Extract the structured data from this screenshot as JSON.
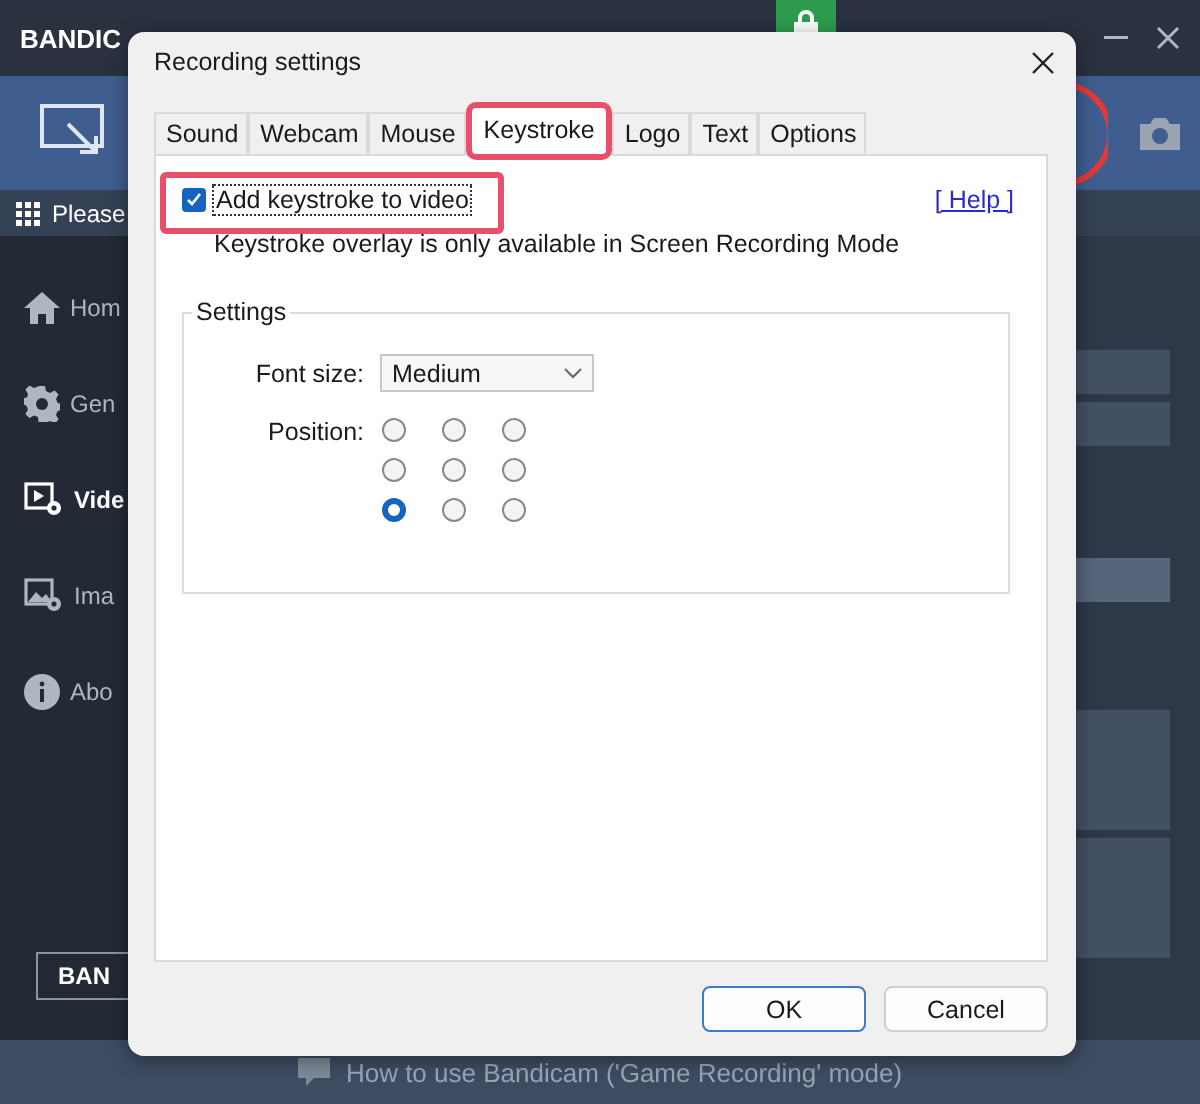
{
  "app": {
    "logo": "BANDIC",
    "nav_hint": "Please",
    "sidebar": [
      {
        "label": "Hom",
        "selected": false
      },
      {
        "label": "Gen",
        "selected": false
      },
      {
        "label": "Vide",
        "selected": true
      },
      {
        "label": "Ima",
        "selected": false
      },
      {
        "label": "Abo",
        "selected": false
      }
    ],
    "footer_logo": "BAN",
    "status_bar": "How to use Bandicam ('Game Recording' mode)"
  },
  "dialog": {
    "title": "Recording settings",
    "tabs": [
      {
        "label": "Sound",
        "selected": false
      },
      {
        "label": "Webcam",
        "selected": false
      },
      {
        "label": "Mouse",
        "selected": false
      },
      {
        "label": "Keystroke",
        "selected": true
      },
      {
        "label": "Logo",
        "selected": false
      },
      {
        "label": "Text",
        "selected": false
      },
      {
        "label": "Options",
        "selected": false
      }
    ],
    "add_keystroke": {
      "label": "Add keystroke to video",
      "checked": true
    },
    "help_link": "[ Help ]",
    "note": "Keystroke overlay is only available in Screen Recording Mode",
    "group_title": "Settings",
    "font_size": {
      "label": "Font size:",
      "value": "Medium"
    },
    "position": {
      "label": "Position:",
      "options": [
        {
          "selected": false
        },
        {
          "selected": false
        },
        {
          "selected": false
        },
        {
          "selected": false
        },
        {
          "selected": false
        },
        {
          "selected": false
        },
        {
          "selected": true
        },
        {
          "selected": false
        },
        {
          "selected": false
        }
      ]
    },
    "buttons": [
      {
        "label": "OK",
        "default": true
      },
      {
        "label": "Cancel",
        "default": false
      }
    ]
  }
}
